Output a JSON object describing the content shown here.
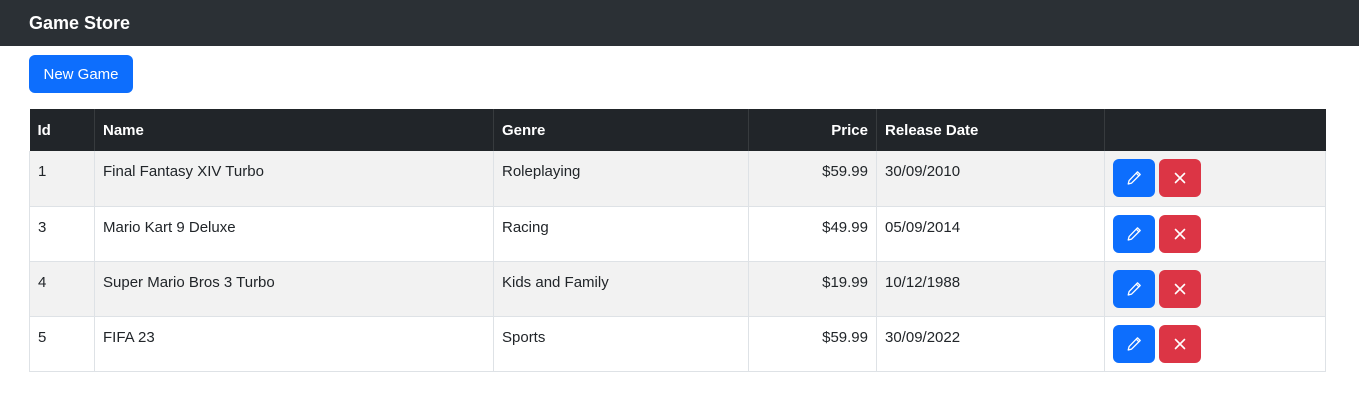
{
  "navbar": {
    "brand": "Game Store"
  },
  "toolbar": {
    "new_game_label": "New Game"
  },
  "table": {
    "headers": {
      "id": "Id",
      "name": "Name",
      "genre": "Genre",
      "price": "Price",
      "release_date": "Release Date",
      "actions": ""
    },
    "rows": [
      {
        "id": "1",
        "name": "Final Fantasy XIV Turbo",
        "genre": "Roleplaying",
        "price": "$59.99",
        "release_date": "30/09/2010"
      },
      {
        "id": "3",
        "name": "Mario Kart 9 Deluxe",
        "genre": "Racing",
        "price": "$49.99",
        "release_date": "05/09/2014"
      },
      {
        "id": "4",
        "name": "Super Mario Bros 3 Turbo",
        "genre": "Kids and Family",
        "price": "$19.99",
        "release_date": "10/12/1988"
      },
      {
        "id": "5",
        "name": "FIFA 23",
        "genre": "Sports",
        "price": "$59.99",
        "release_date": "30/09/2022"
      }
    ]
  },
  "icons": {
    "edit": "pencil-icon",
    "delete": "x-icon"
  },
  "colors": {
    "navbar_bg": "#2b3035",
    "table_header_bg": "#212529",
    "primary": "#0d6efd",
    "danger": "#dc3545",
    "striped_row": "#f2f2f2"
  }
}
